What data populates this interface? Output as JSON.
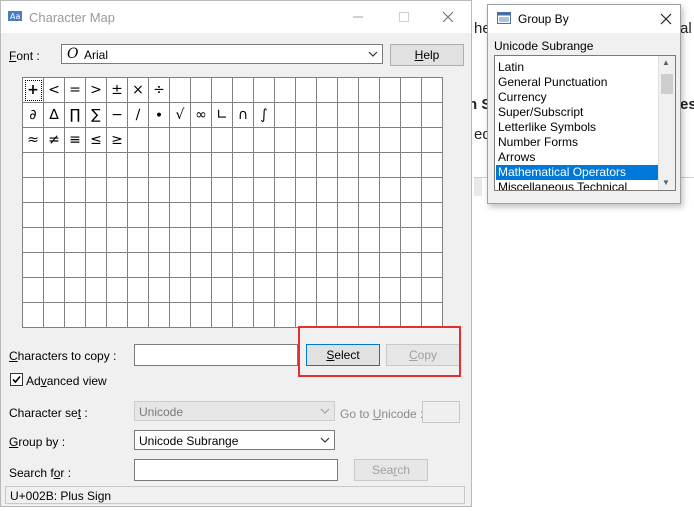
{
  "character_map": {
    "title": "Character Map",
    "font_label_pre": "F",
    "font_label_post": "ont :",
    "font_value": "Arial",
    "help_label_pre": "H",
    "help_label_post": "elp",
    "characters": [
      "+",
      "<",
      "=",
      ">",
      "±",
      "×",
      "÷",
      "",
      "",
      "",
      "",
      "",
      "",
      "",
      "",
      "",
      "",
      "",
      "",
      "",
      "∂",
      "∆",
      "∏",
      "∑",
      "−",
      "∕",
      "∙",
      "√",
      "∞",
      "∟",
      "∩",
      "∫",
      "",
      "",
      "",
      "",
      "",
      "",
      "",
      "",
      "≈",
      "≠",
      "≡",
      "≤",
      "≥"
    ],
    "chars_to_copy_pre": "C",
    "chars_to_copy_post": "haracters to copy :",
    "select_label_pre": "S",
    "select_label_post": "elect",
    "copy_label_pre": "C",
    "copy_label_post": "opy",
    "advanced_pre": "Ad",
    "advanced_u": "v",
    "advanced_post": "anced view",
    "advanced_checked": true,
    "charset_label_pre": "Character se",
    "charset_label_u": "t",
    "charset_label_post": " :",
    "charset_value": "Unicode",
    "goto_pre": "Go to ",
    "goto_u": "U",
    "goto_post": "nicode :",
    "groupby_label_pre": "",
    "groupby_label_u": "G",
    "groupby_label_post": "roup by :",
    "groupby_value": "Unicode Subrange",
    "search_label_pre": "Search f",
    "search_label_u": "o",
    "search_label_post": "r :",
    "search_button_pre": "Sea",
    "search_button_u": "r",
    "search_button_post": "ch",
    "status": "U+002B: Plus Sign"
  },
  "group_by": {
    "title": "Group By",
    "label": "Unicode Subrange",
    "items": [
      "Latin",
      "General Punctuation",
      "Currency",
      "Super/Subscript",
      "Letterlike Symbols",
      "Number Forms",
      "Arrows",
      "Mathematical Operators",
      "Miscellaneous Technical"
    ],
    "selected_index": 7
  },
  "background": {
    "partial_1": "he",
    "partial_2": "al",
    "partial_3": "n S",
    "partial_4": "es",
    "partial_5": "ed"
  },
  "colors": {
    "highlight": "#e03030",
    "selection": "#0078d7"
  }
}
